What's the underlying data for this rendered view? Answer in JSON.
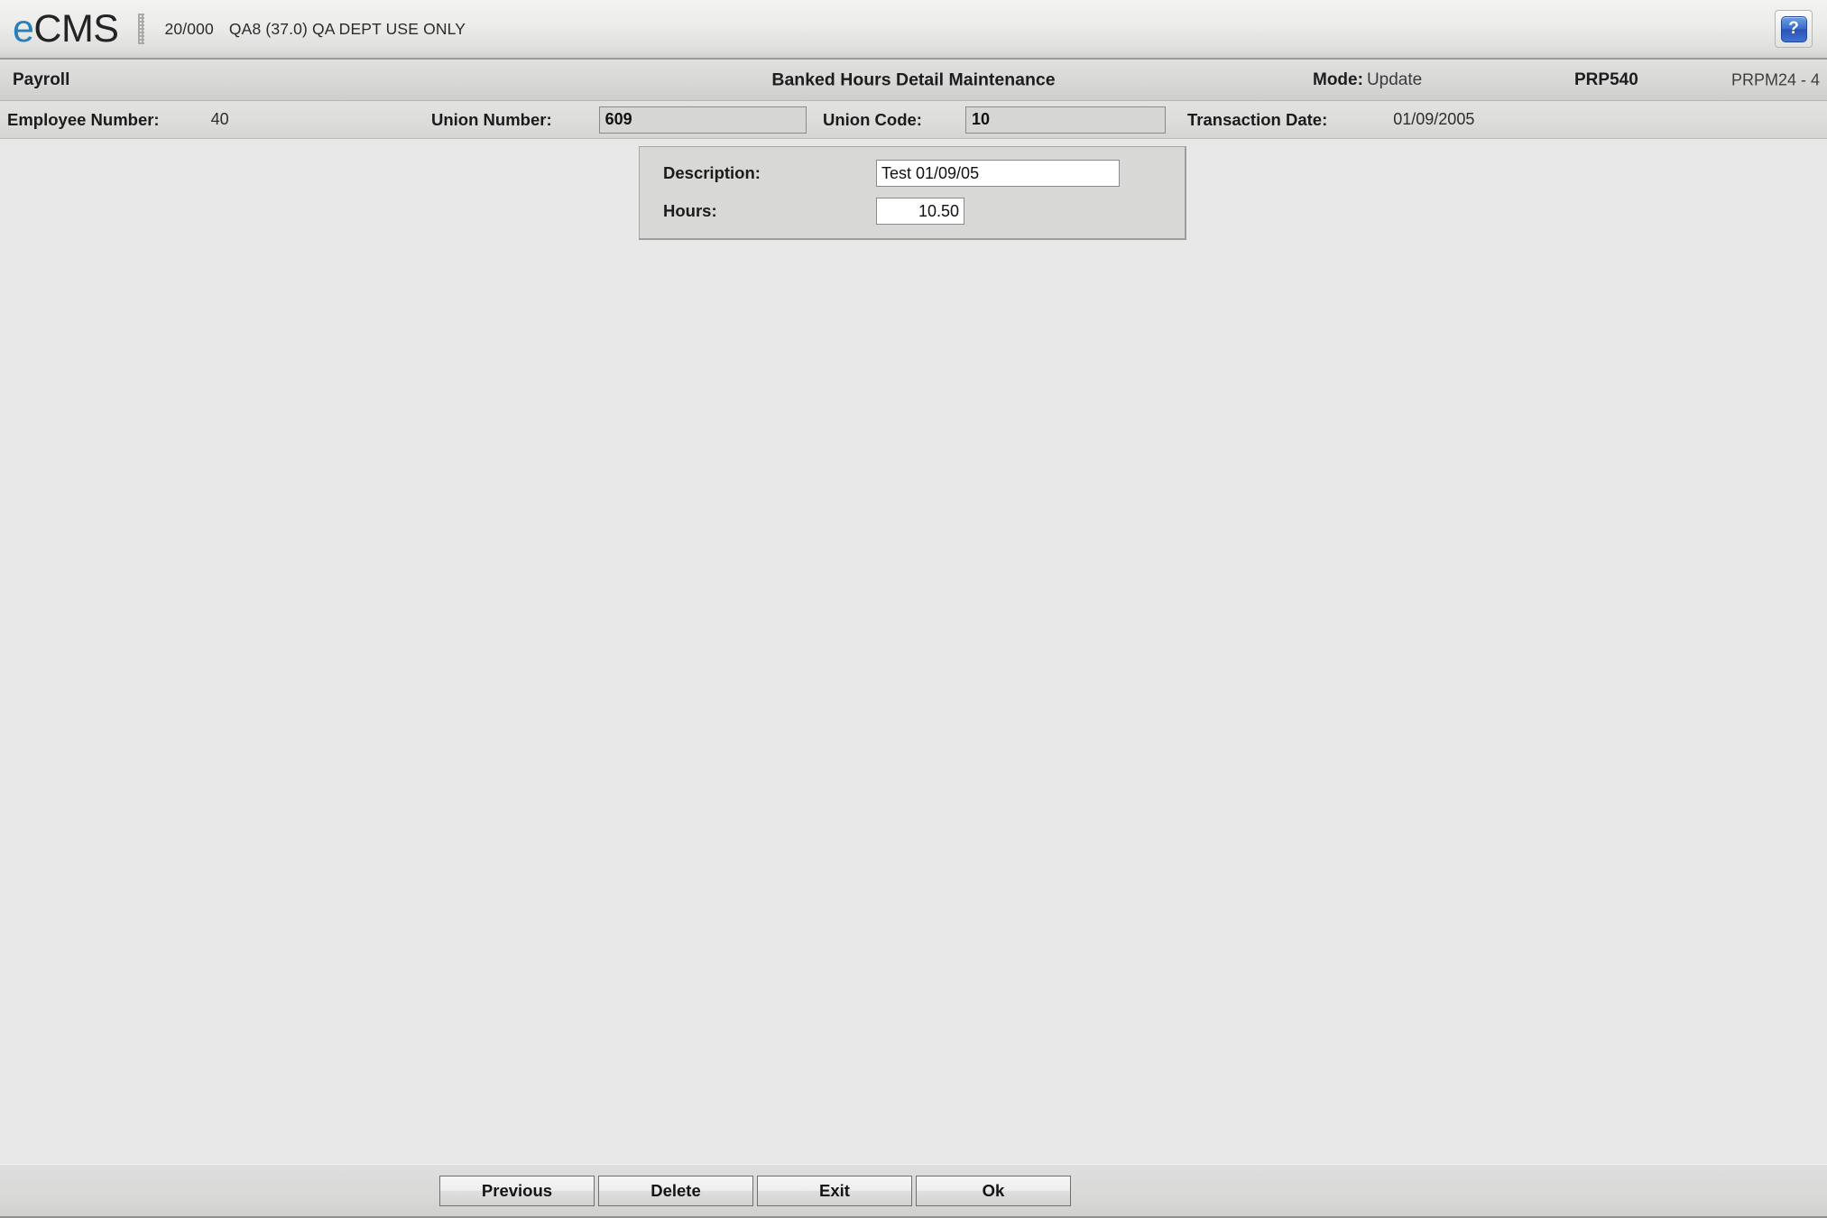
{
  "brand": {
    "logo_prefix": "e",
    "logo_suffix": "CMS",
    "session_id": "20/000",
    "session_info": "QA8 (37.0) QA DEPT USE ONLY",
    "help_glyph": "?"
  },
  "titlebar": {
    "module": "Payroll",
    "screen_title": "Banked Hours Detail Maintenance",
    "mode_label": "Mode:",
    "mode_value": "Update",
    "program_id": "PRP540",
    "screen_id": "PRPM24 - 4"
  },
  "keybar": {
    "employee_number_label": "Employee Number:",
    "employee_number_value": "40",
    "union_number_label": "Union Number:",
    "union_number_value": "609",
    "union_code_label": "Union Code:",
    "union_code_value": "10",
    "transaction_date_label": "Transaction Date:",
    "transaction_date_value": "01/09/2005"
  },
  "detail_panel": {
    "description_label": "Description:",
    "description_value": "Test 01/09/05",
    "hours_label": "Hours:",
    "hours_value": "10.50"
  },
  "actions": {
    "previous": "Previous",
    "delete": "Delete",
    "exit": "Exit",
    "ok": "Ok"
  },
  "colors": {
    "brand_accent": "#2a7fb8",
    "page_background": "#e8e8e8",
    "panel_background": "#d8d8d7",
    "help_button_blue": "#3a6fce"
  }
}
